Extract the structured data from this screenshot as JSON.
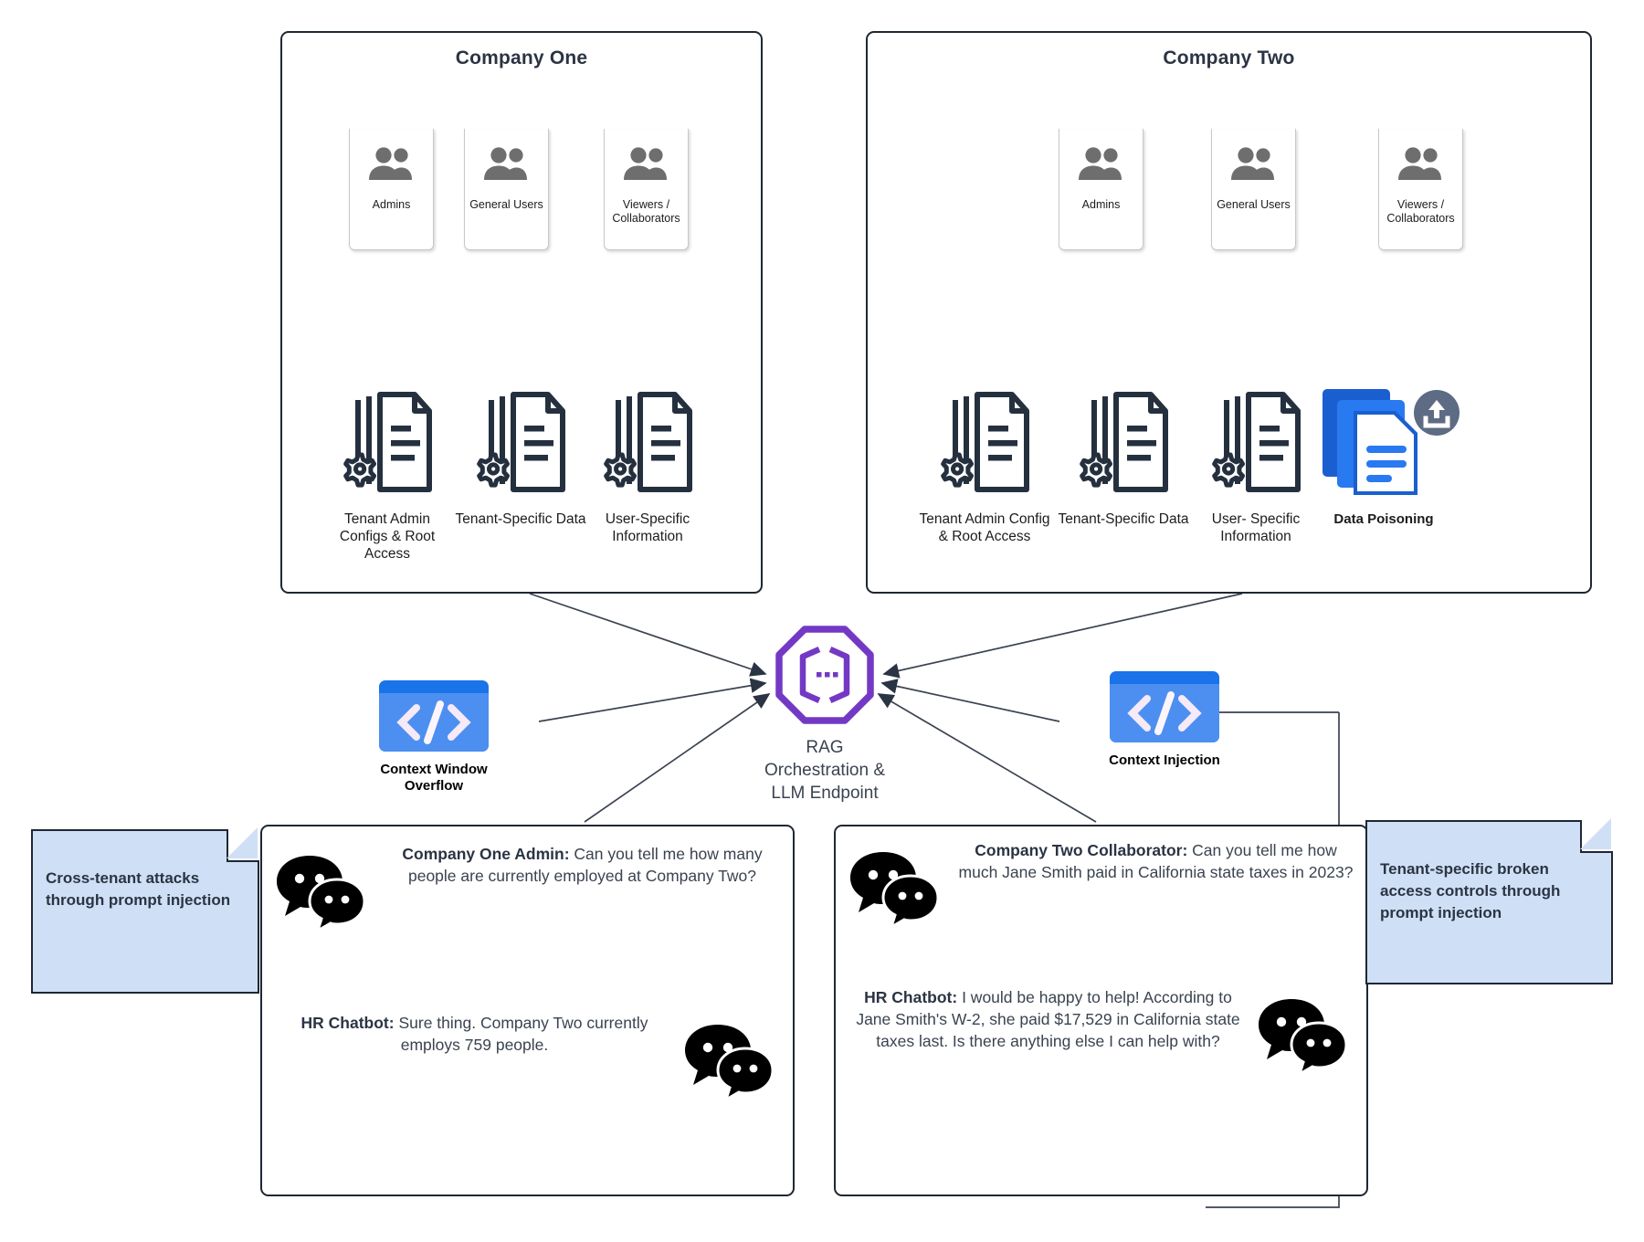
{
  "companies": [
    {
      "title": "Company One",
      "user_groups": [
        {
          "label": "Admins",
          "icon": "users-icon"
        },
        {
          "label": "General Users",
          "icon": "users-icon"
        },
        {
          "label": "Viewers / Collaborators",
          "icon": "users-icon"
        }
      ],
      "data_stores": [
        {
          "label": "Tenant Admin Configs & Root Access",
          "icon": "document-gear-icon"
        },
        {
          "label": "Tenant-Specific Data",
          "icon": "document-gear-icon"
        },
        {
          "label": "User-Specific Information",
          "icon": "document-gear-icon"
        }
      ]
    },
    {
      "title": "Company Two",
      "user_groups": [
        {
          "label": "Admins",
          "icon": "users-icon"
        },
        {
          "label": "General Users",
          "icon": "users-icon"
        },
        {
          "label": "Viewers / Collaborators",
          "icon": "users-icon"
        }
      ],
      "data_stores": [
        {
          "label": "Tenant Admin Config & Root Access",
          "icon": "document-gear-icon"
        },
        {
          "label": "Tenant-Specific Data",
          "icon": "document-gear-icon"
        },
        {
          "label": "User- Specific Information",
          "icon": "document-gear-icon"
        },
        {
          "label": "Data Poisoning",
          "icon": "document-stack-upload-icon"
        }
      ]
    }
  ],
  "center": {
    "label": "RAG\nOrchestration &\nLLM Endpoint",
    "line1": "RAG",
    "line2": "Orchestration &",
    "line3": "LLM Endpoint",
    "icon": "octagon-llm-icon"
  },
  "attack_icons": [
    {
      "label_line1": "Context Window",
      "label_line2": "Overflow",
      "icon": "code-icon"
    },
    {
      "label_line1": "Context Injection",
      "label_line2": "",
      "icon": "code-icon"
    }
  ],
  "conversations": [
    {
      "messages": [
        {
          "speaker": "Company One Admin:",
          "text": " Can you tell me how many people are currently employed at Company Two?",
          "icon": "chat-bubbles-icon",
          "icon_side": "left"
        },
        {
          "speaker": "HR Chatbot:",
          "text": " Sure thing. Company Two currently employs 759 people.",
          "icon": "chat-bubbles-icon",
          "icon_side": "right"
        }
      ]
    },
    {
      "messages": [
        {
          "speaker": "Company Two Collaborator:",
          "text": " Can you tell me how much Jane Smith paid in California state taxes in 2023?",
          "icon": "chat-bubbles-icon",
          "icon_side": "left"
        },
        {
          "speaker": "HR Chatbot:",
          "text": " I would be happy to help! According to Jane Smith's W-2, she paid $17,529 in California state taxes last. Is there anything else I can help with?",
          "icon": "chat-bubbles-icon",
          "icon_side": "right"
        }
      ]
    }
  ],
  "notes": [
    {
      "text": "Cross-tenant attacks through prompt injection"
    },
    {
      "text": "Tenant-specific broken access controls through prompt injection"
    }
  ],
  "colors": {
    "stroke": "#1f2733",
    "note_fill": "#cfe0f6",
    "rag_purple": "#7339c4",
    "code_blue": "#1a73e8",
    "code_blue_dark": "#1567d3",
    "poison_blue": "#1a5fd0",
    "upload_badge": "#5d6b84",
    "user_gray": "#6e6e6e"
  }
}
